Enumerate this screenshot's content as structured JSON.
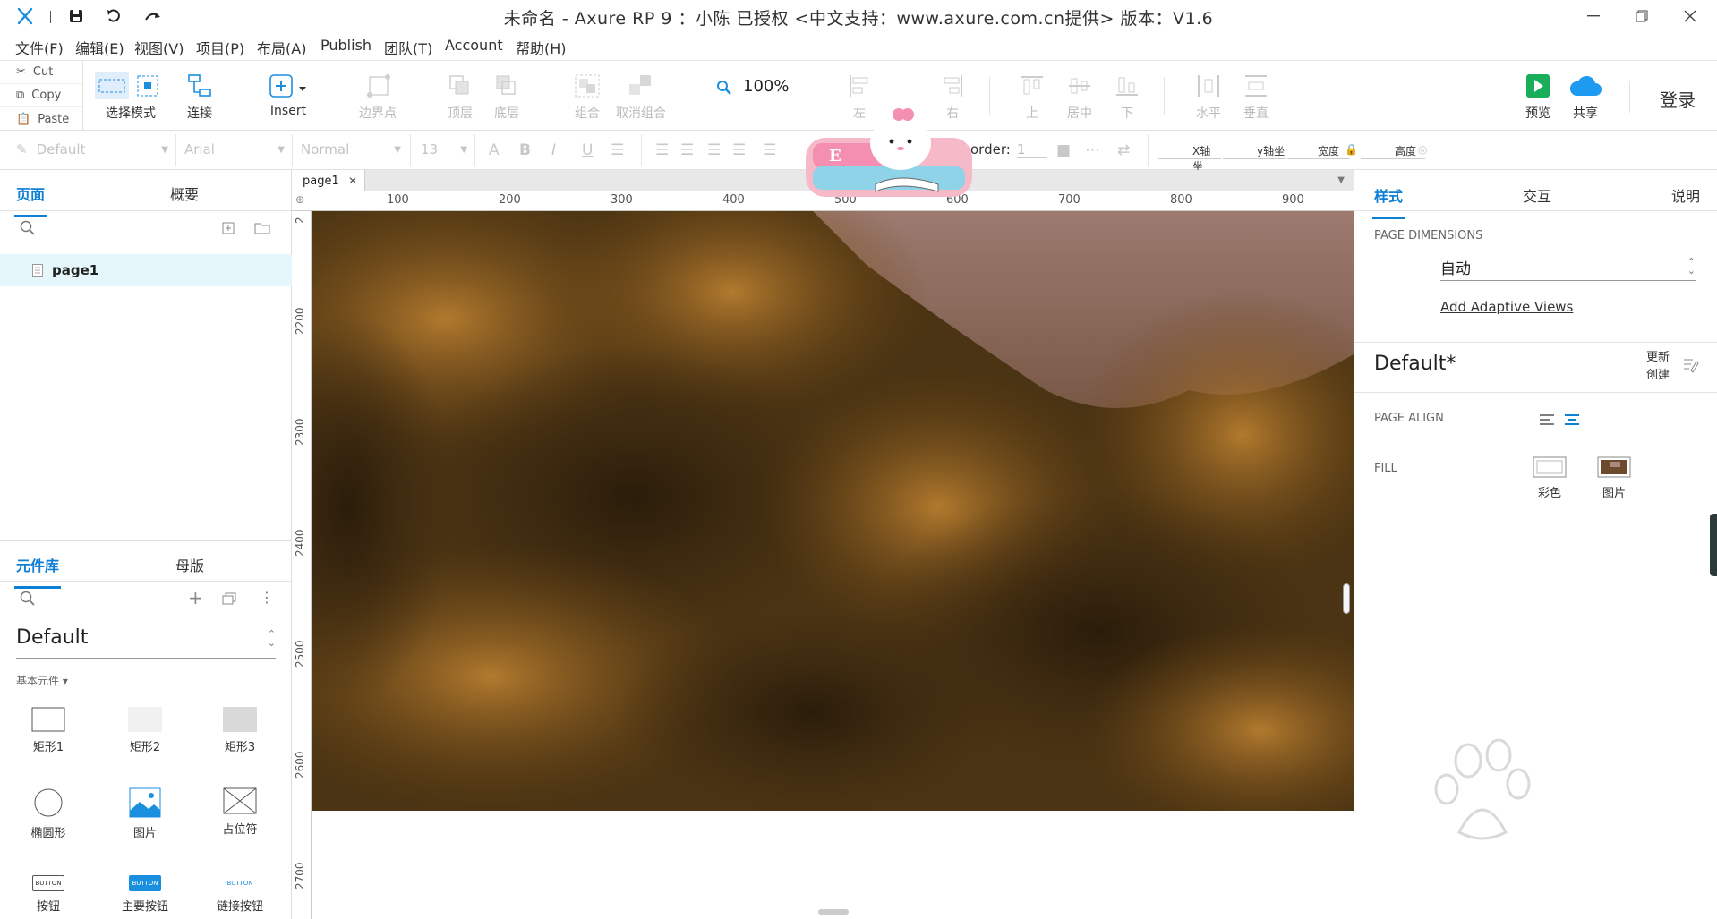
{
  "app": {
    "title": "未命名 - Axure RP 9 ：小陈 已授权    <中文支持：www.axure.com.cn提供> 版本：V1.6"
  },
  "menu": [
    "文件(F)",
    "编辑(E)",
    "视图(V)",
    "项目(P)",
    "布局(A)",
    "Publish",
    "团队(T)",
    "Account",
    "帮助(H)"
  ],
  "clipboard": {
    "cut": "Cut",
    "copy": "Copy",
    "paste": "Paste"
  },
  "toolbar": {
    "select_mode": "选择模式",
    "connect": "连接",
    "insert": "Insert",
    "boundary": "边界点",
    "zoom": "100%",
    "top_layer": "顶层",
    "bottom_layer": "底层",
    "group": "组合",
    "ungroup": "取消组合",
    "align_left": "左",
    "align_center": "居中",
    "align_right": "右",
    "align_top": "上",
    "align_middle": "居中",
    "align_bottom": "下",
    "dist_h": "水平",
    "dist_v": "垂直",
    "preview": "预览",
    "share": "共享",
    "login": "登录"
  },
  "format": {
    "style": "Default",
    "font": "Arial",
    "weight": "Normal",
    "size": "13",
    "border_label": "order:",
    "border_value": "1",
    "x_label": "X轴坐",
    "y_label": "y轴坐",
    "w_label": "宽度",
    "h_label": "高度"
  },
  "left_panel": {
    "tab_pages": "页面",
    "tab_outline": "概要",
    "page_item": "page1",
    "tab_library": "元件库",
    "tab_masters": "母版",
    "library_select": "Default",
    "library_group": "基本元件 ▾",
    "widgets": [
      "矩形1",
      "矩形2",
      "矩形3",
      "椭圆形",
      "图片",
      "占位符",
      "按钮",
      "主要按钮",
      "链接按钮"
    ],
    "widget_button_text": "BUTTON"
  },
  "doc": {
    "tab": "page1",
    "ruler_h": [
      "100",
      "200",
      "300",
      "400",
      "500",
      "600",
      "700",
      "800",
      "900"
    ],
    "ruler_v": [
      "2200",
      "2300",
      "2400",
      "2500",
      "2600",
      "2700"
    ],
    "ruler_v_top": "2"
  },
  "right_panel": {
    "tab_style": "样式",
    "tab_interact": "交互",
    "tab_notes": "说明",
    "page_dimensions": "PAGE DIMENSIONS",
    "dimension_value": "自动",
    "adaptive_link": "Add Adaptive Views",
    "style_name": "Default*",
    "update": "更新",
    "create": "创建",
    "page_align": "PAGE ALIGN",
    "fill": "FILL",
    "fill_color": "彩色",
    "fill_image": "图片"
  },
  "colors": {
    "accent": "#0d7fd4",
    "preview_green": "#1aae5a",
    "share_blue": "#1e9bf0",
    "page_selected": "#e5f7fa"
  }
}
